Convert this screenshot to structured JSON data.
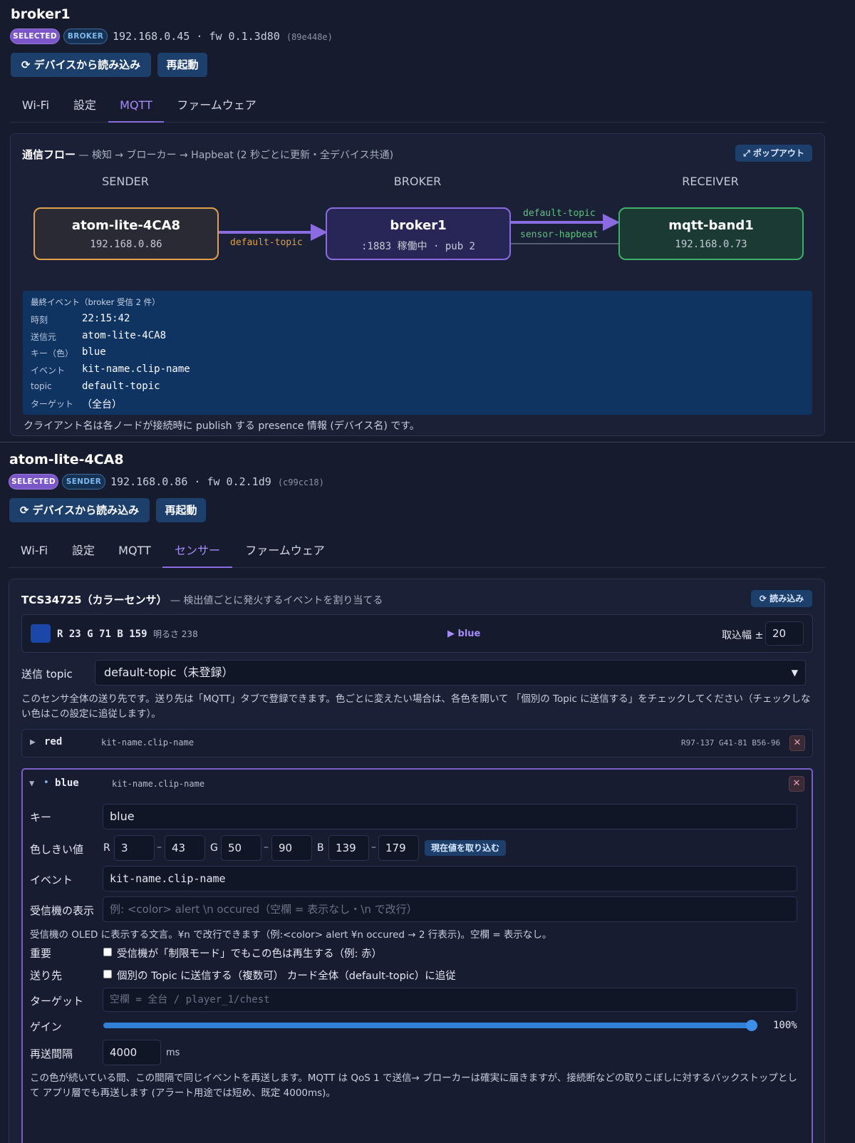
{
  "broker": {
    "title": "broker1",
    "badges": [
      "SELECTED",
      "BROKER"
    ],
    "ip": "192.168.0.45",
    "fw_sep": "·",
    "fw": "fw 0.1.3d80",
    "hash": "(89e448e)",
    "read_button": "⟳ デバイスから読み込み",
    "reboot_button": "再起動",
    "tabs": [
      "Wi-Fi",
      "設定",
      "MQTT",
      "ファームウェア"
    ],
    "active_tab": "MQTT"
  },
  "flow": {
    "title": "通信フロー",
    "subtitle": "— 検知 → ブローカー → Hapbeat (2 秒ごとに更新・全デバイス共通)",
    "popout": "⤢ ポップアウト",
    "columns": [
      "SENDER",
      "BROKER",
      "RECEIVER"
    ],
    "sender": {
      "name": "atom-lite-4CA8",
      "detail": "192.168.0.86"
    },
    "broker": {
      "name": "broker1",
      "detail": ":1883 稼働中 · pub 2"
    },
    "receiver": {
      "name": "mqtt-band1",
      "detail": "192.168.0.73"
    },
    "edge_sender_broker": "default-topic",
    "edge_broker_receiver_1": "default-topic",
    "edge_broker_receiver_2": "sensor-hapbeat",
    "colors": {
      "sender": "#e0a04a",
      "broker": "#8b6be0",
      "receiver": "#3fae6a"
    }
  },
  "last_event": {
    "heading": "最終イベント（broker 受信 2 件）",
    "rows": [
      {
        "k": "時刻",
        "v": "22:15:42"
      },
      {
        "k": "送信元",
        "v": "atom-lite-4CA8"
      },
      {
        "k": "キー（色）",
        "v": "blue"
      },
      {
        "k": "イベント",
        "v": "kit-name.clip-name"
      },
      {
        "k": "topic",
        "v": "default-topic"
      },
      {
        "k": "ターゲット",
        "v": "（全台）"
      }
    ],
    "note": "クライアント名は各ノードが接続時に publish する presence 情報 (デバイス名) です。"
  },
  "sender": {
    "title": "atom-lite-4CA8",
    "badges": [
      "SELECTED",
      "SENDER"
    ],
    "ip": "192.168.0.86",
    "fw_sep": "·",
    "fw": "fw 0.2.1d9",
    "hash": "(c99cc18)",
    "read_button": "⟳ デバイスから読み込み",
    "reboot_button": "再起動",
    "tabs": [
      "Wi-Fi",
      "設定",
      "MQTT",
      "センサー",
      "ファームウェア"
    ],
    "active_tab": "センサー"
  },
  "sensor": {
    "title": "TCS34725（カラーセンサ）",
    "subtitle": "— 検出値ごとに発火するイベントを割り当てる",
    "reload": "⟳ 読み込み",
    "swatch_color": "#1a47a8",
    "reading": {
      "R": "23",
      "G": "71",
      "B": "159",
      "brightness_label": "明るさ",
      "brightness": "238"
    },
    "detected": "▶ blue",
    "range_label": "取込幅 ±",
    "range_value": "20",
    "topic_label": "送信 topic",
    "topic_value": "default-topic（未登録）",
    "topic_help": "このセンサ全体の送り先です。送り先は「MQTT」タブで登録できます。色ごとに変えたい場合は、各色を開いて 「個別の Topic に送信する」をチェックしてください（チェックしない色はこの設定に追従します）。",
    "red_row": {
      "arrow": "▶",
      "name": "red",
      "event": "kit-name.clip-name",
      "ranges": "R97-137 G41-81 B56-96"
    },
    "blue": {
      "arrow": "▼",
      "dot": "•",
      "name": "blue",
      "event_header": "kit-name.clip-name",
      "key_label": "キー",
      "key_value": "blue",
      "threshold_label": "色しきい値",
      "r_label": "R",
      "r_min": "3",
      "r_max": "43",
      "g_label": "G",
      "g_min": "50",
      "g_max": "90",
      "b_label": "B",
      "b_min": "139",
      "b_max": "179",
      "capture_button": "現在値を取り込む",
      "event_label": "イベント",
      "event_value": "kit-name.clip-name",
      "display_label": "受信機の表示",
      "display_placeholder": "例: <color> alert \\n occured（空欄 = 表示なし・\\n で改行）",
      "display_help": "受信機の OLED に表示する文言。¥n で改行できます（例:<color> alert ¥n occured → 2 行表示)。空欄 = 表示なし。",
      "important_label": "重要",
      "important_text": "受信機が「制限モード」でもこの色は再生する（例: 赤）",
      "dest_label": "送り先",
      "dest_text": "個別の Topic に送信する（複数可） カード全体（default-topic）に追従",
      "target_label": "ターゲット",
      "target_placeholder": "空欄 = 全台 / player_1/chest",
      "gain_label": "ゲイン",
      "gain_value": "100%",
      "gain_fraction": 1.0,
      "resend_label": "再送間隔",
      "resend_value": "4000",
      "resend_unit": "ms",
      "resend_help": "この色が続いている間、この間隔で同じイベントを再送します。MQTT は QoS 1 で送信→ ブローカーは確実に届きますが、接続断などの取りこぼしに対するバックストップとして アプリ層でも再送します (アラート用途では短め、既定 4000ms)。"
    }
  }
}
